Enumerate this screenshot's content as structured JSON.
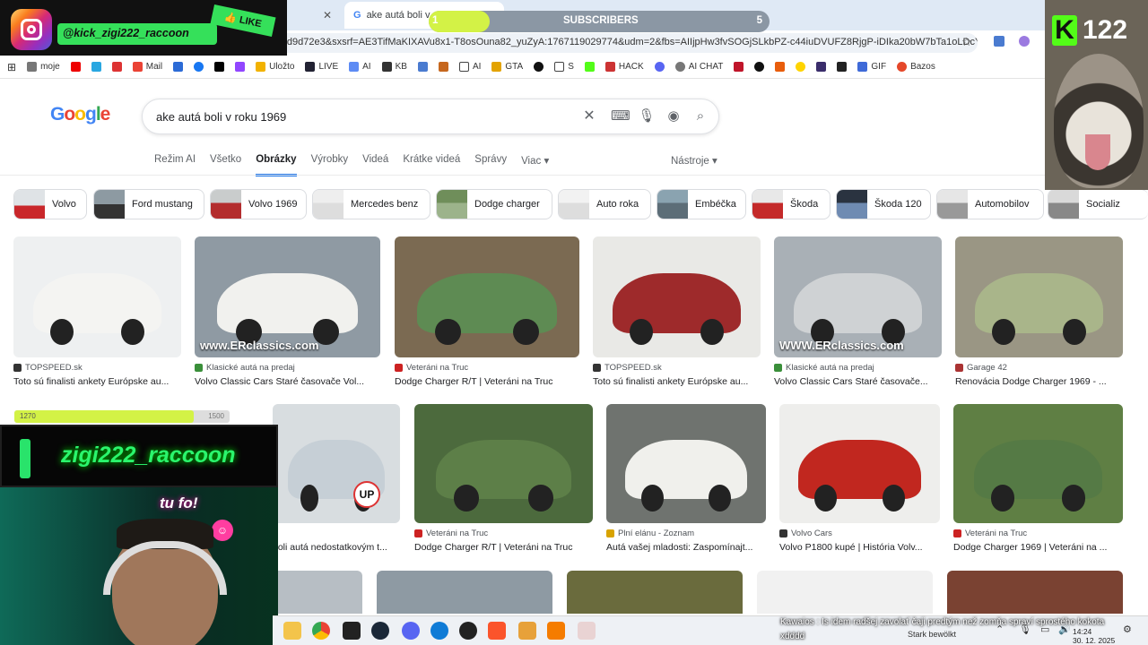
{
  "browser": {
    "tabs": [
      {
        "title": "ake autá boli v ro"
      }
    ],
    "url": "ffd9d72e3&sxsrf=AE3TifMaKIXAVu8x1-T8osOuna82_yuZyA:1767119029774&udm=2&fbs=AIIjpHw3fvSOGjSLkbPZ-c44iuDVUFZ8RjgP-iDIka20bW7bTa1oLDcYqi...",
    "bookmarks": [
      "moje",
      "Mail",
      "Uložto",
      "LIVE",
      "AI",
      "KB",
      "AI",
      "GTA",
      "S",
      "HACK",
      "AI CHAT",
      "GIF",
      "Bazos"
    ]
  },
  "google": {
    "query": "ake autá boli v roku 1969",
    "logo": "Google",
    "nav": [
      "Režim AI",
      "Všetko",
      "Obrázky",
      "Výrobky",
      "Videá",
      "Krátke videá",
      "Správy",
      "Viac"
    ],
    "tools": "Nástroje ▾",
    "chips": [
      "Volvo",
      "Ford mustang",
      "Volvo 1969",
      "Mercedes benz",
      "Dodge charger",
      "Auto roka",
      "Embéčka",
      "Škoda",
      "Škoda 120",
      "Automobilov",
      "Socializ"
    ],
    "results_row1": [
      {
        "source": "TOPSPEED.sk",
        "title": "Toto sú finalisti ankety Európske au...",
        "color": "#eef0f1",
        "car": "#f4f4f2",
        "src_color": "#333",
        "watermark": ""
      },
      {
        "source": "Klasické autá na predaj",
        "title": "Volvo Classic Cars Staré časovače Vol...",
        "color": "#8f9aa3",
        "car": "#f1f1ee",
        "src_color": "#3a8f3a",
        "watermark": "www.ERclassics.com"
      },
      {
        "source": "Veteráni na Truc",
        "title": "Dodge Charger R/T | Veteráni na Truc",
        "color": "#7b6a52",
        "car": "#5e8b53",
        "src_color": "#c22",
        "watermark": ""
      },
      {
        "source": "TOPSPEED.sk",
        "title": "Toto sú finalisti ankety Európske au...",
        "color": "#e9e9e6",
        "car": "#9e2a2b",
        "src_color": "#333",
        "watermark": ""
      },
      {
        "source": "Klasické autá na predaj",
        "title": "Volvo Classic Cars Staré časovače...",
        "color": "#a9b0b6",
        "car": "#cfd2d4",
        "src_color": "#3a8f3a",
        "watermark": "WWW.ERclassics.com"
      },
      {
        "source": "Garage 42",
        "title": "Renovácia Dodge Charger 1969 - ...",
        "color": "#9a9684",
        "car": "#a9b58a",
        "src_color": "#a33",
        "watermark": ""
      }
    ],
    "results_row2": [
      {
        "source": "",
        "title": "boli autá nedostatkovým t...",
        "color": "#d8dde0",
        "car": "#c6cfd6",
        "src_color": "#999",
        "watermark": ""
      },
      {
        "source": "Veteráni na Truc",
        "title": "Dodge Charger R/T | Veteráni na Truc",
        "color": "#4c6a3d",
        "car": "#5d7f48",
        "src_color": "#c22",
        "watermark": ""
      },
      {
        "source": "Plní elánu - Zoznam",
        "title": "Autá vašej mladosti: Zaspomínajt...",
        "color": "#6f736f",
        "car": "#f0f0ec",
        "src_color": "#d8a300",
        "watermark": ""
      },
      {
        "source": "Volvo Cars",
        "title": "Volvo P1800 kupé | História Volv...",
        "color": "#eeeeec",
        "car": "#c1271f",
        "src_color": "#333",
        "watermark": ""
      },
      {
        "source": "Veteráni na Truc",
        "title": "Dodge Charger 1969 | Veteráni na ...",
        "color": "#5f7f44",
        "car": "#557a45",
        "src_color": "#c22",
        "watermark": ""
      }
    ]
  },
  "overlay": {
    "ig_handle": "@kick_zigi222_raccoon",
    "like": "👍 LIKE",
    "subscribers_label": "SUBSCRIBERS",
    "sub_current": "1",
    "sub_goal": "5",
    "kick_count": "122",
    "streamer_name": "zigi222_raccoon",
    "cam_text": "tu fo!",
    "row_label": "1270",
    "row_right": "1500",
    "up_badge": "UP",
    "chat": "Kawaios : Is idem radšej zavolať čaji predtým než zomňa spraví sprostého kokota xdddd",
    "stark": "Stark bewölkt",
    "clock_time": "14:24",
    "clock_date": "30. 12. 2025"
  }
}
